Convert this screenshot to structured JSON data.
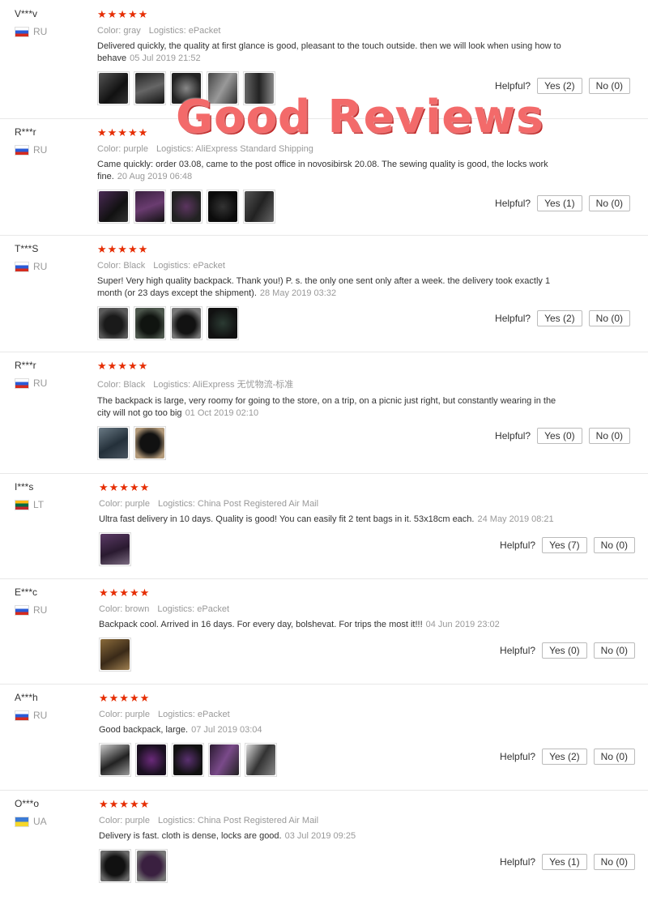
{
  "labels": {
    "helpful": "Helpful?"
  },
  "banner": "Good Reviews",
  "reviews": [
    {
      "user": "V***v",
      "country": "RU",
      "stars": "★★★★★",
      "color": "Color: gray",
      "logistics": "Logistics: ePacket",
      "text": "Delivered quickly, the quality at first glance is good, pleasant to the touch outside. then we will look when using how to behave",
      "date": "05 Jul 2019 21:52",
      "yes": "Yes (2)",
      "no": "No (0)"
    },
    {
      "user": "R***r",
      "country": "RU",
      "stars": "★★★★★",
      "color": "Color: purple",
      "logistics": "Logistics: AliExpress Standard Shipping",
      "text": "Came quickly: order 03.08, came to the post office in novosibirsk 20.08. The sewing quality is good, the locks work fine.",
      "date": "20 Aug 2019 06:48",
      "yes": "Yes (1)",
      "no": "No (0)"
    },
    {
      "user": "T***S",
      "country": "RU",
      "stars": "★★★★★",
      "color": "Color: Black",
      "logistics": "Logistics: ePacket",
      "text": "Super! Very high quality backpack. Thank you!) P. s. the only one sent only after a week. the delivery took exactly 1 month (or 23 days except the shipment).",
      "date": "28 May 2019 03:32",
      "yes": "Yes (2)",
      "no": "No (0)"
    },
    {
      "user": "R***r",
      "country": "RU",
      "stars": "★★★★★",
      "color": "Color: Black",
      "logistics": "Logistics: AliExpress 无忧物流-标准",
      "text": "The backpack is large, very roomy for going to the store, on a trip, on a picnic just right, but constantly wearing in the city will not go too big",
      "date": "01 Oct 2019 02:10",
      "yes": "Yes (0)",
      "no": "No (0)"
    },
    {
      "user": "I***s",
      "country": "LT",
      "stars": "★★★★★",
      "color": "Color: purple",
      "logistics": "Logistics: China Post Registered Air Mail",
      "text": "Ultra fast delivery in 10 days. Quality is good! You can easily fit 2 tent bags in it. 53x18cm each.",
      "date": "24 May 2019 08:21",
      "yes": "Yes (7)",
      "no": "No (0)"
    },
    {
      "user": "E***c",
      "country": "RU",
      "stars": "★★★★★",
      "color": "Color: brown",
      "logistics": "Logistics: ePacket",
      "text": "Backpack cool. Arrived in 16 days. For every day, bolshevat. For trips the most it!!!",
      "date": "04 Jun 2019 23:02",
      "yes": "Yes (0)",
      "no": "No (0)"
    },
    {
      "user": "A***h",
      "country": "RU",
      "stars": "★★★★★",
      "color": "Color: purple",
      "logistics": "Logistics: ePacket",
      "text": "Good backpack, large.",
      "date": "07 Jul 2019 03:04",
      "yes": "Yes (2)",
      "no": "No (0)"
    },
    {
      "user": "O***o",
      "country": "UA",
      "stars": "★★★★★",
      "color": "Color: purple",
      "logistics": "Logistics: China Post Registered Air Mail",
      "text": "Delivery is fast. cloth is dense, locks are good.",
      "date": "03 Jul 2019 09:25",
      "yes": "Yes (1)",
      "no": "No (0)"
    }
  ]
}
